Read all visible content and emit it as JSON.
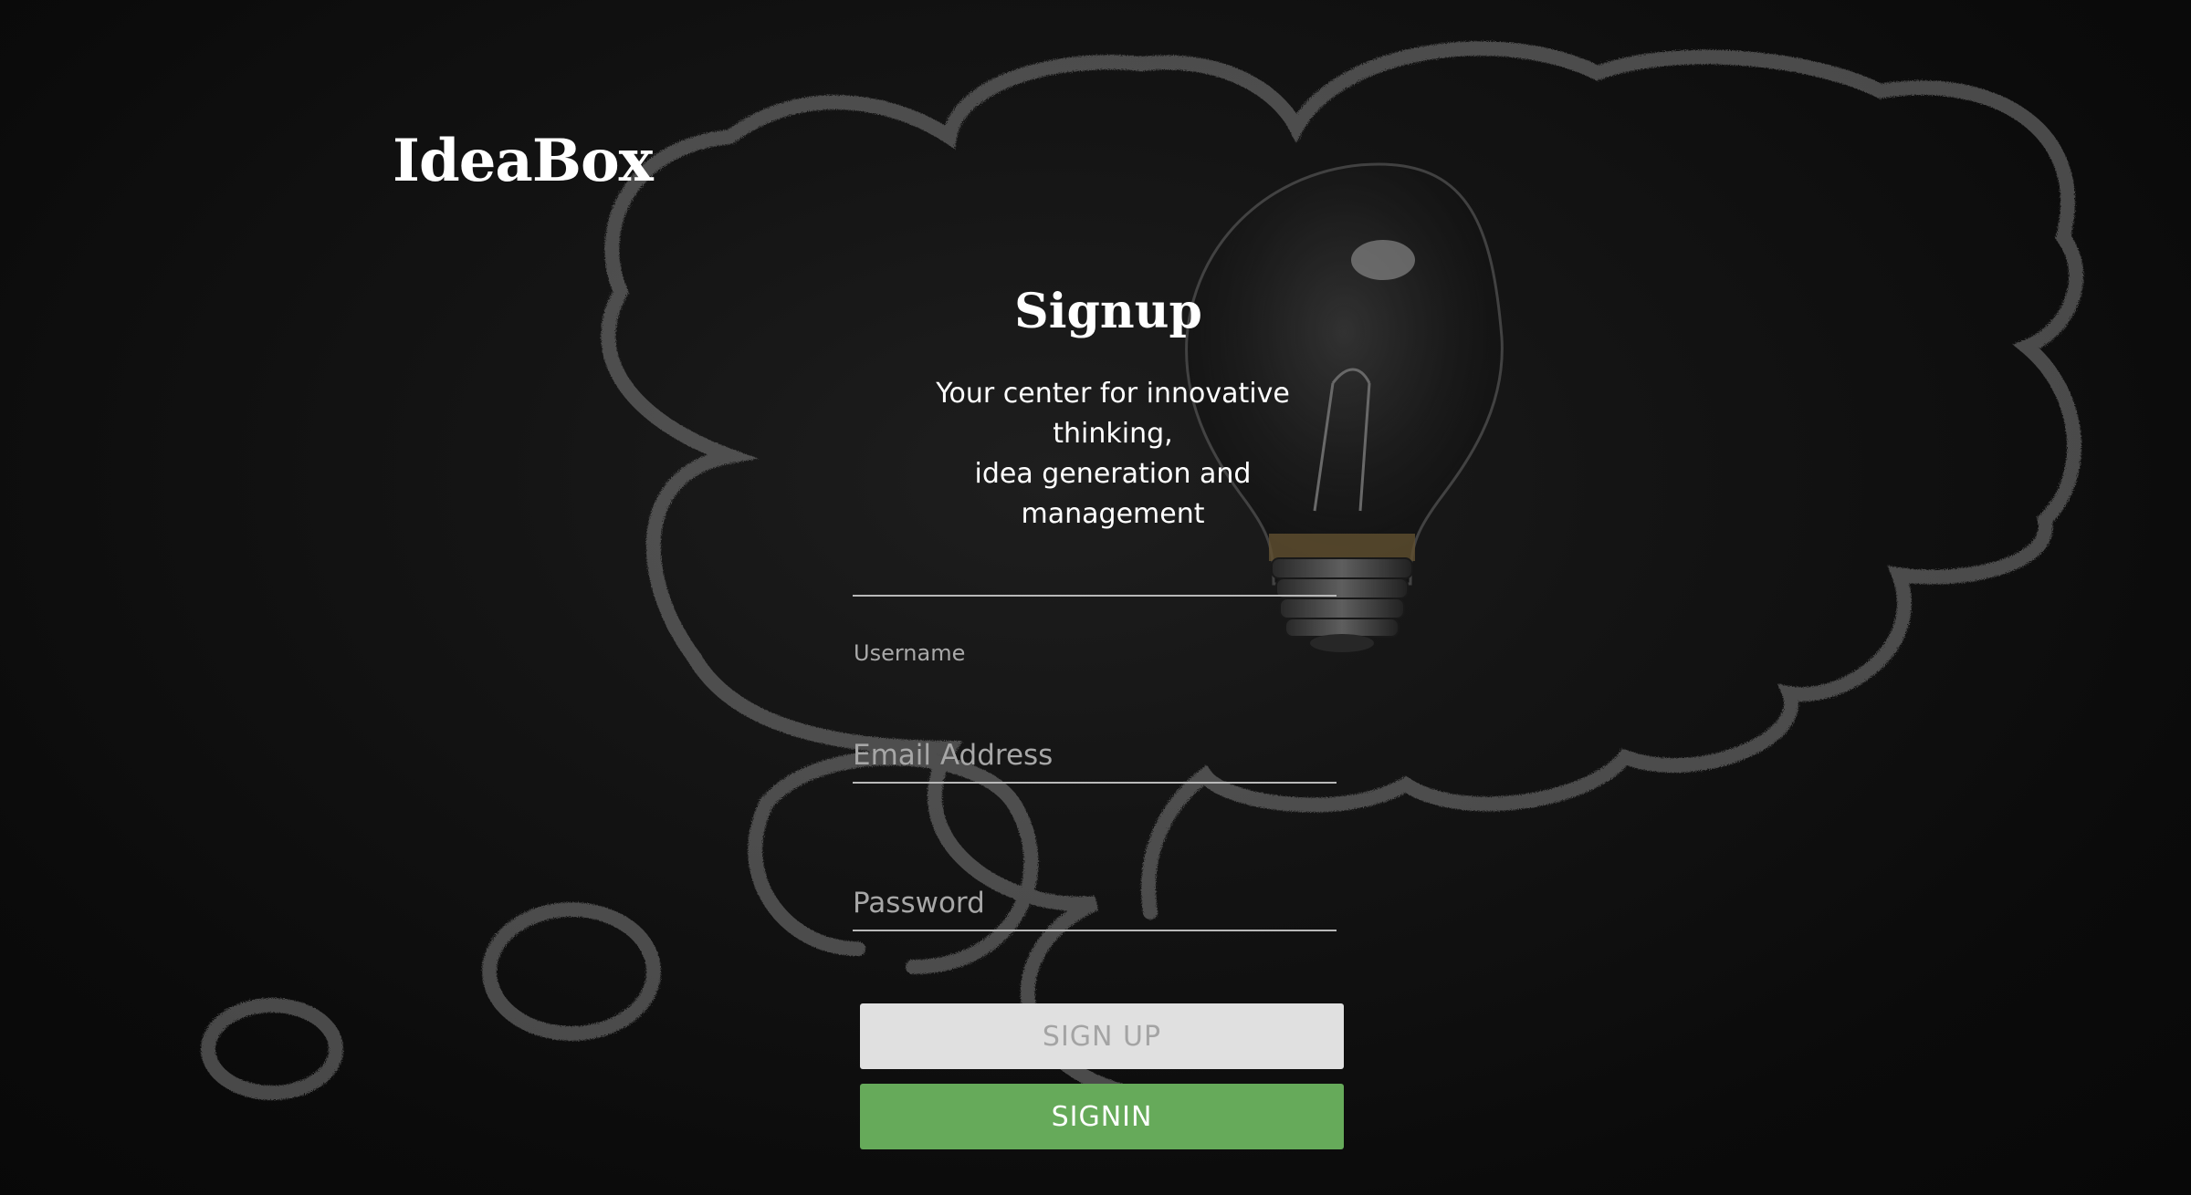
{
  "app": {
    "logo": "IdeaBox"
  },
  "form": {
    "title": "Signup",
    "subtitle_line1": "Your center for innovative thinking,",
    "subtitle_line2": "idea generation and management",
    "username": {
      "label": "Username",
      "value": "",
      "placeholder": ""
    },
    "email": {
      "value": "",
      "placeholder": "Email Address"
    },
    "password": {
      "value": "",
      "placeholder": "Password"
    },
    "signup_label": "SIGN UP",
    "signin_label": "SIGNIN"
  },
  "colors": {
    "signin_button": "#66aa5a",
    "signup_button": "#e0e0e0",
    "chalk": "#8a8a8a"
  },
  "icons": {
    "background": "lightbulb-thought-cloud-chalkboard"
  }
}
